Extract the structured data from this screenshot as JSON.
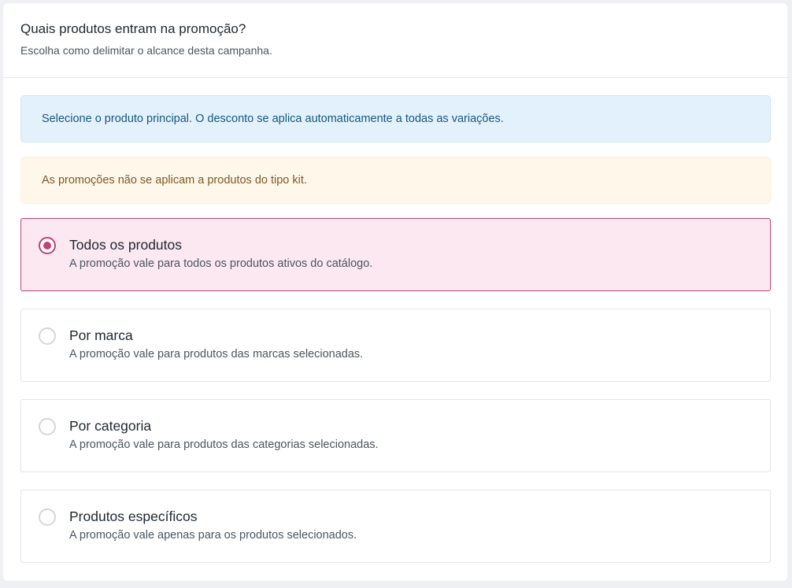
{
  "header": {
    "title": "Quais produtos entram na promoção?",
    "subtitle": "Escolha como delimitar o alcance desta campanha."
  },
  "alerts": {
    "info": "Selecione o produto principal. O desconto se aplica automaticamente a todas as variações.",
    "warning": "As promoções não se aplicam a produtos do tipo kit."
  },
  "options": [
    {
      "title": "Todos os produtos",
      "description": "A promoção vale para todos os produtos ativos do catálogo.",
      "selected": true
    },
    {
      "title": "Por marca",
      "description": "A promoção vale para produtos das marcas selecionadas.",
      "selected": false
    },
    {
      "title": "Por categoria",
      "description": "A promoção vale para produtos das categorias selecionadas.",
      "selected": false
    },
    {
      "title": "Produtos específicos",
      "description": "A promoção vale apenas para os produtos selecionados.",
      "selected": false
    }
  ],
  "colors": {
    "accent": "#c1427a",
    "selected_bg": "#fbe8f1",
    "info_bg": "#e3f1fc",
    "info_text": "#15577d",
    "warning_bg": "#fff7e9",
    "warning_text": "#7a5a2a"
  }
}
